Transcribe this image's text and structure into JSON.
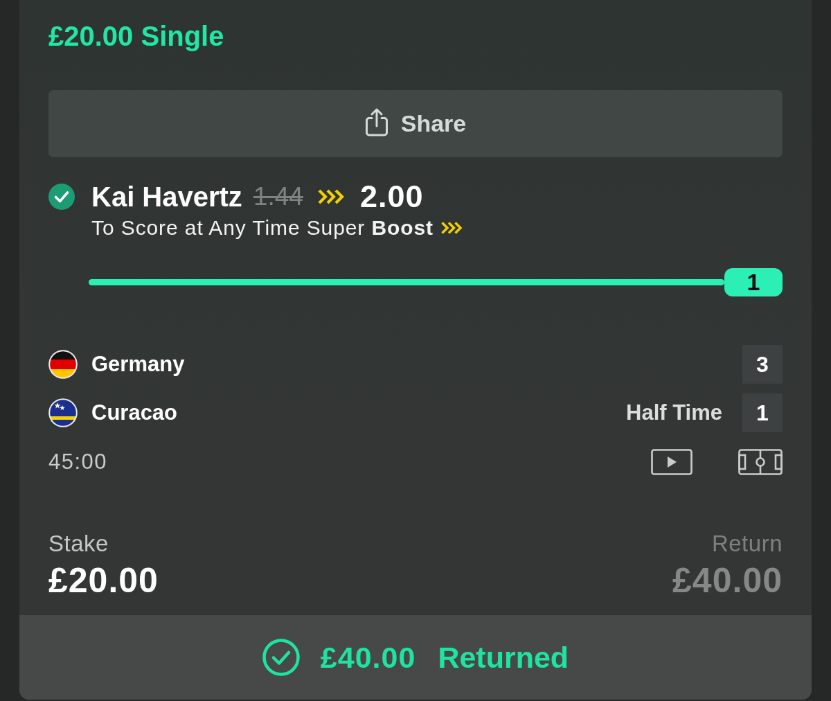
{
  "bet_title": "£20.00 Single",
  "share_button": {
    "label": "Share"
  },
  "selection": {
    "won": true,
    "name": "Kai Havertz",
    "old_odds": "1.44",
    "boosted_odds": "2.00",
    "market": "To Score at Any Time Super **Boost**",
    "progress": {
      "level": 1,
      "count": "1"
    }
  },
  "match": {
    "teams": [
      {
        "name": "Germany",
        "score": "3"
      },
      {
        "name": "Curacao",
        "score": "1"
      }
    ],
    "status": "Half Time",
    "clock": "45:00"
  },
  "stake": {
    "label": "Stake",
    "value": "£20.00"
  },
  "return": {
    "label": "Return",
    "value": "£40.00"
  },
  "result_bar": {
    "amount": "£40.00",
    "status": "Returned"
  }
}
